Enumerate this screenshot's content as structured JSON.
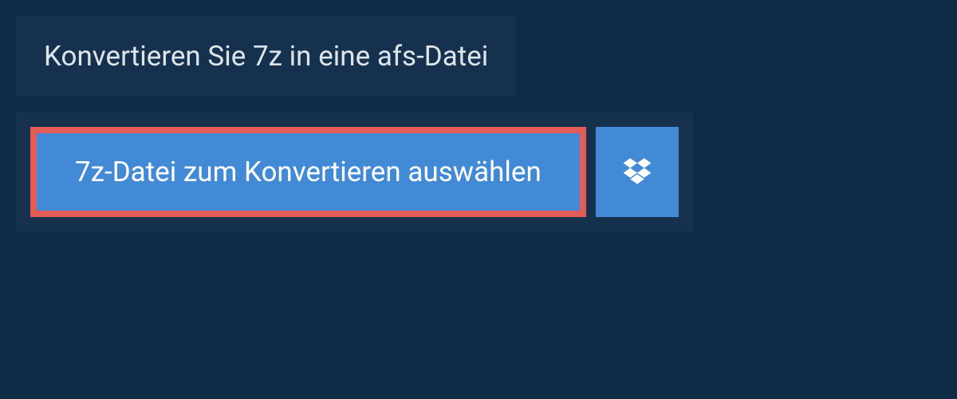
{
  "header": {
    "title": "Konvertieren Sie 7z in eine afs-Datei"
  },
  "upload": {
    "select_file_label": "7z-Datei zum Konvertieren auswählen",
    "dropbox_icon_name": "dropbox-icon"
  },
  "colors": {
    "background": "#0f2c47",
    "panel": "#15314d",
    "button": "#4289d6",
    "highlight_border": "#e35c56",
    "text_light": "#dde4ea",
    "text_white": "#ffffff"
  }
}
